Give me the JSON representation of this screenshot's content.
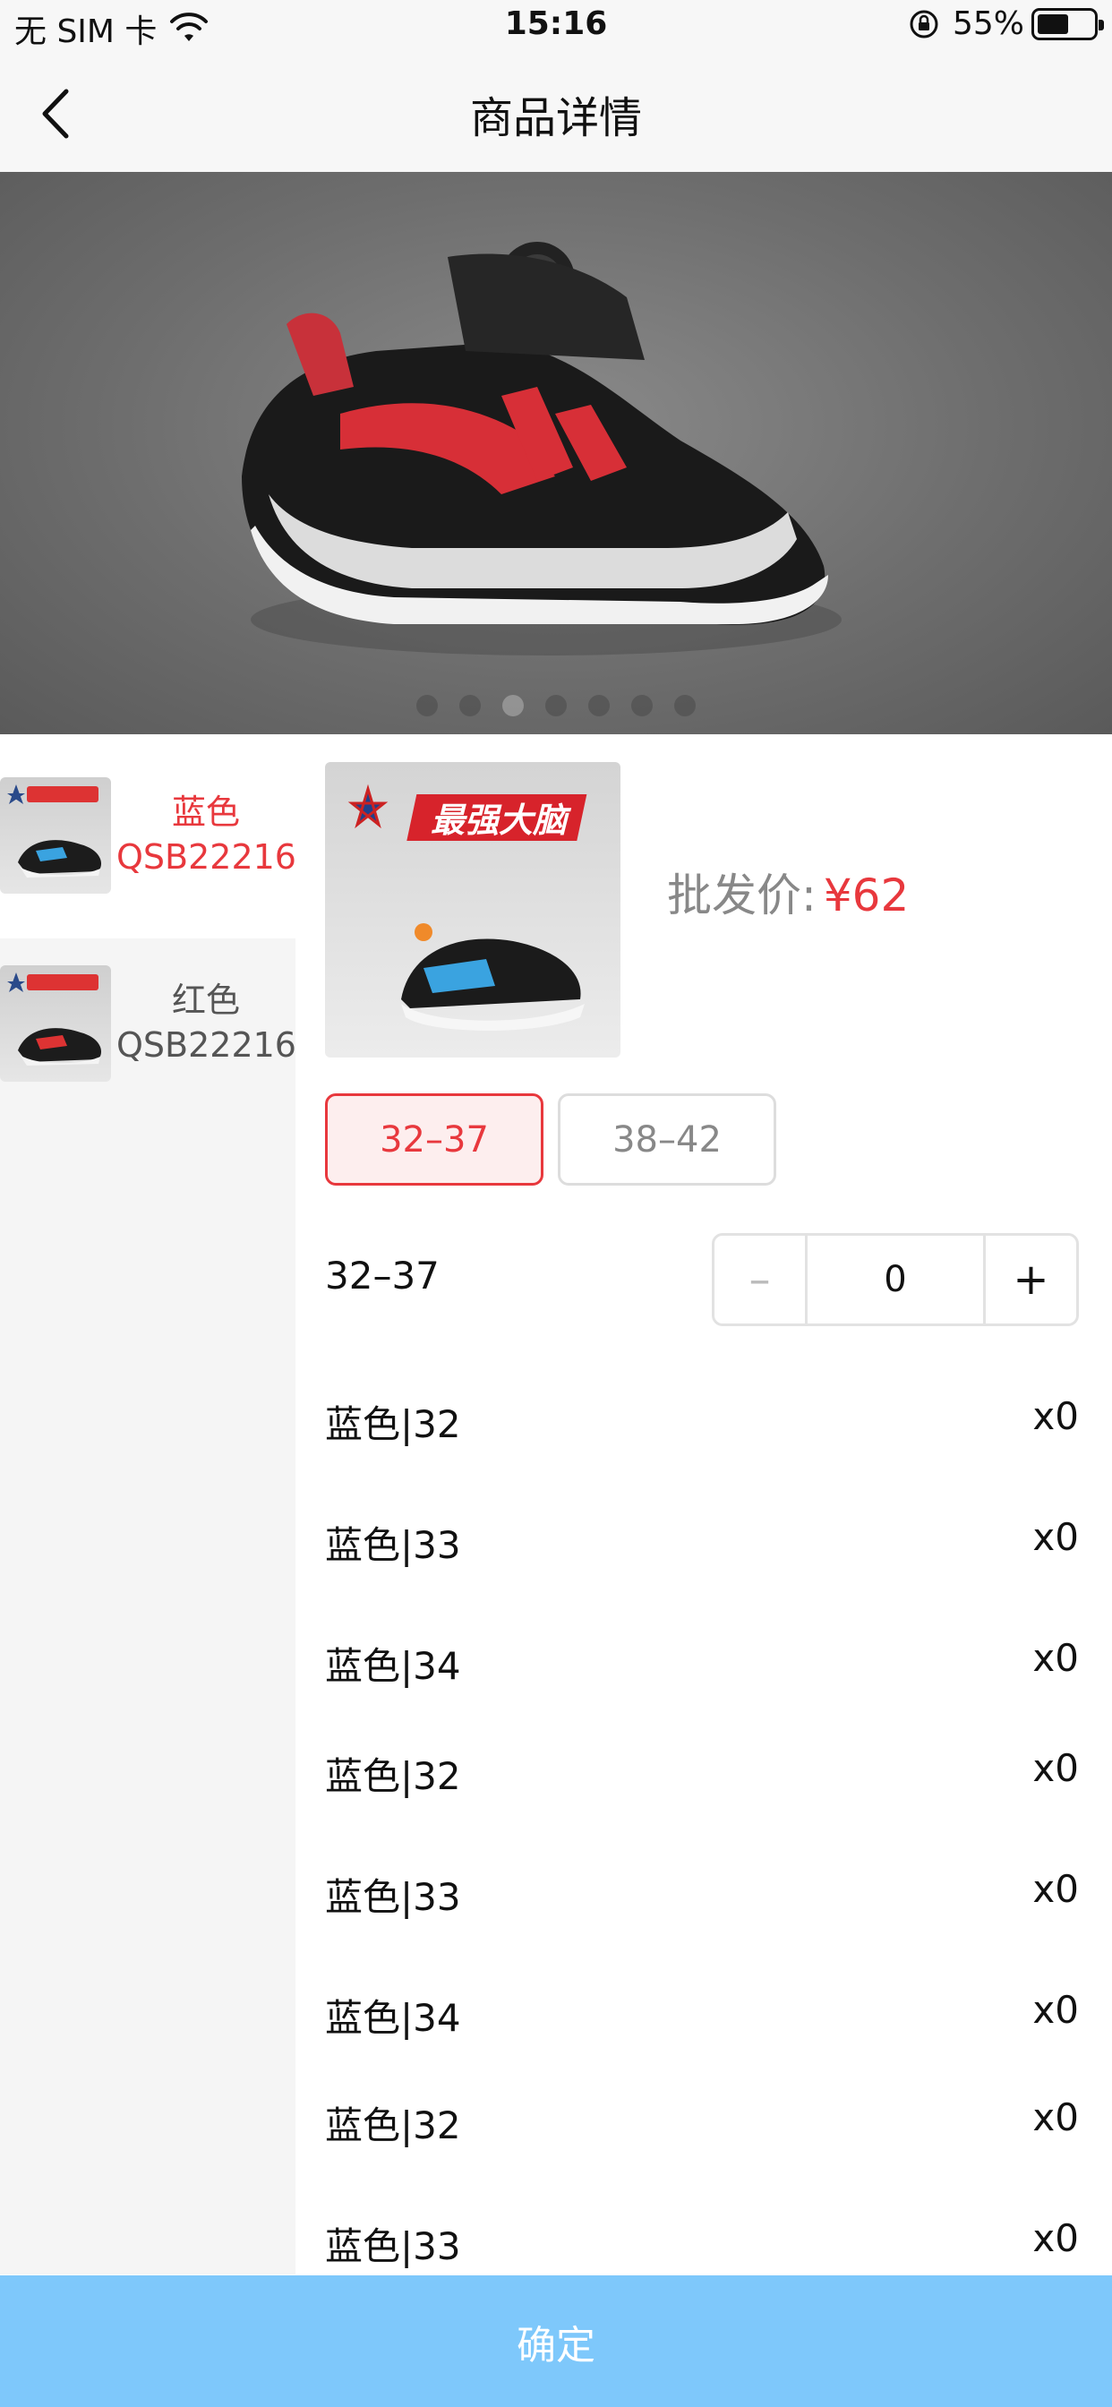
{
  "status_bar": {
    "carrier": "无 SIM 卡",
    "time": "15:16",
    "battery": "55%",
    "battery_level": 0.55
  },
  "nav": {
    "title": "商品详情",
    "back_icon": "chevron-left-icon"
  },
  "carousel": {
    "total": 7,
    "active_index": 2
  },
  "variants": [
    {
      "name": "蓝色",
      "code": "QSB22216",
      "selected": true
    },
    {
      "name": "红色",
      "code": "QSB22216",
      "selected": false
    }
  ],
  "product": {
    "brand_logo_text": "最强大脑",
    "price_label": "批发价:",
    "price_value": "¥62"
  },
  "size_tabs": [
    "32–37",
    "38–42"
  ],
  "selected_size_tab": 0,
  "quantity": {
    "range_label": "32–37",
    "minus": "–",
    "value": "0",
    "plus": "+"
  },
  "sku_rows": [
    {
      "name": "蓝色|32",
      "qty": "x0"
    },
    {
      "name": "蓝色|33",
      "qty": "x0"
    },
    {
      "name": "蓝色|34",
      "qty": "x0"
    },
    {
      "name": "蓝色|32",
      "qty": "x0"
    },
    {
      "name": "蓝色|33",
      "qty": "x0"
    },
    {
      "name": "蓝色|34",
      "qty": "x0"
    },
    {
      "name": "蓝色|32",
      "qty": "x0"
    },
    {
      "name": "蓝色|33",
      "qty": "x0"
    }
  ],
  "footer": {
    "confirm_label": "确定"
  },
  "colors": {
    "accent_red": "#e8383d",
    "confirm_blue": "#7ec8fb"
  }
}
